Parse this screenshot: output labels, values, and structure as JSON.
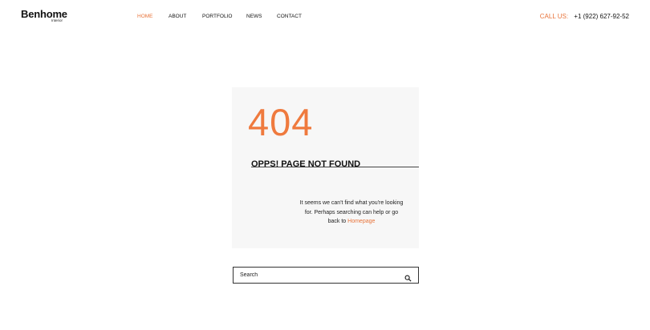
{
  "brand": {
    "name": "Benhome",
    "tagline": "Interior"
  },
  "nav": {
    "items": [
      {
        "label": "HOME",
        "active": true
      },
      {
        "label": "ABOUT",
        "active": false
      },
      {
        "label": "PORTFOLIO",
        "active": false
      },
      {
        "label": "NEWS",
        "active": false
      },
      {
        "label": "CONTACT",
        "active": false
      }
    ]
  },
  "contact": {
    "label": "CALL US:",
    "phone": "+1 (922) 627-92-52"
  },
  "error": {
    "code": "404",
    "title": "OPPS! PAGE NOT FOUND",
    "message": "It seems we can't find what you're looking for. Perhaps searching can help or go back to",
    "link_label": "Homepage"
  },
  "search": {
    "placeholder": "Search",
    "value": "",
    "icon": "search-icon"
  },
  "colors": {
    "accent": "#e8743b",
    "panel": "#f7f7f7",
    "text": "#111111"
  }
}
